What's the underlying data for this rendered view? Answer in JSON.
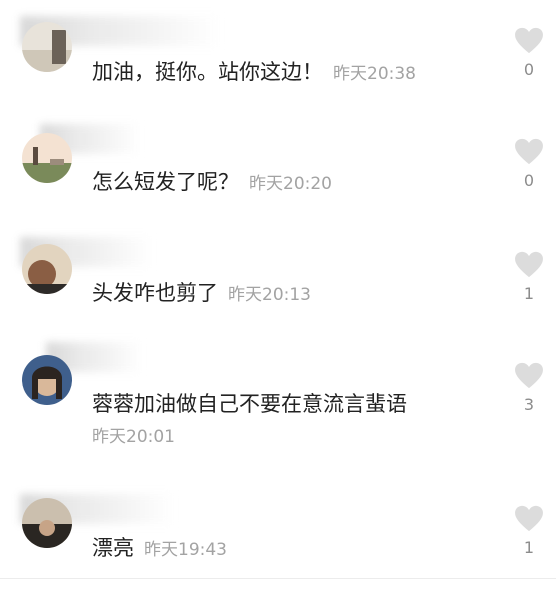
{
  "comments": [
    {
      "text": "加油，挺你。站你这边！",
      "time": "昨天20:38",
      "likes": "0"
    },
    {
      "text": "怎么短发了呢？",
      "time": "昨天20:20",
      "likes": "0"
    },
    {
      "text": "头发咋也剪了",
      "time": "昨天20:13",
      "likes": "1"
    },
    {
      "text": "蓉蓉加油做自己不要在意流言蜚语",
      "time": "昨天20:01",
      "likes": "3"
    },
    {
      "text": "漂亮",
      "time": "昨天19:43",
      "likes": "1"
    }
  ],
  "icons": {
    "like": "heart-icon"
  },
  "colors": {
    "text": "#222222",
    "time": "#a3a3a3",
    "heart": "#dcdcdc",
    "count": "#8c8c8c"
  }
}
